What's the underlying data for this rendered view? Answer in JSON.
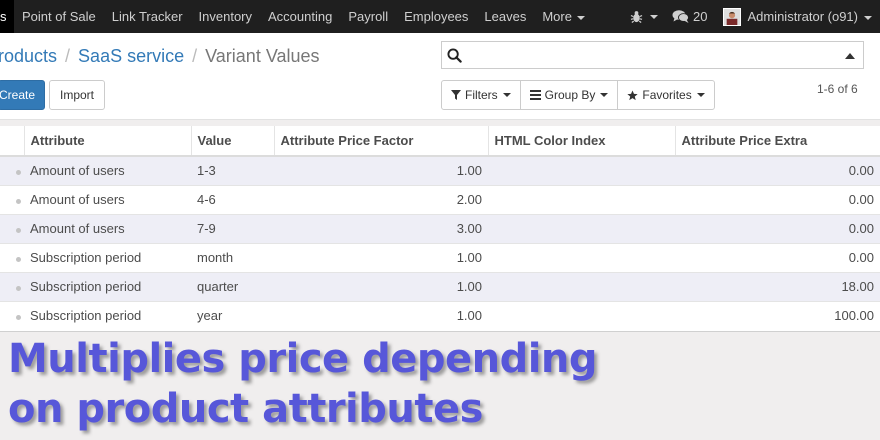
{
  "navbar": {
    "first_item": "s",
    "menu": [
      {
        "label": "Point of Sale",
        "caret": false
      },
      {
        "label": "Link Tracker",
        "caret": false
      },
      {
        "label": "Inventory",
        "caret": false
      },
      {
        "label": "Accounting",
        "caret": false
      },
      {
        "label": "Payroll",
        "caret": false
      },
      {
        "label": "Employees",
        "caret": false
      },
      {
        "label": "Leaves",
        "caret": false
      },
      {
        "label": "More",
        "caret": true
      }
    ],
    "debug_icon": "bug-icon",
    "messages_count": "20",
    "user": "Administrator (o91)"
  },
  "breadcrumb": {
    "items": [
      "roducts",
      "SaaS service"
    ],
    "current": "Variant Values"
  },
  "search": {
    "placeholder": ""
  },
  "buttons": {
    "create": "Create",
    "import": "Import"
  },
  "filters": {
    "filters": "Filters",
    "group_by": "Group By",
    "favorites": "Favorites"
  },
  "pager": "1-6 of 6",
  "table": {
    "columns": [
      "Attribute",
      "Value",
      "Attribute Price Factor",
      "HTML Color Index",
      "Attribute Price Extra"
    ],
    "rows": [
      {
        "attribute": "Amount of users",
        "value": "1-3",
        "factor": "1.00",
        "color_index": "",
        "extra": "0.00"
      },
      {
        "attribute": "Amount of users",
        "value": "4-6",
        "factor": "2.00",
        "color_index": "",
        "extra": "0.00"
      },
      {
        "attribute": "Amount of users",
        "value": "7-9",
        "factor": "3.00",
        "color_index": "",
        "extra": "0.00"
      },
      {
        "attribute": "Subscription period",
        "value": "month",
        "factor": "1.00",
        "color_index": "",
        "extra": "0.00"
      },
      {
        "attribute": "Subscription period",
        "value": "quarter",
        "factor": "1.00",
        "color_index": "",
        "extra": "18.00"
      },
      {
        "attribute": "Subscription period",
        "value": "year",
        "factor": "1.00",
        "color_index": "",
        "extra": "100.00"
      }
    ]
  },
  "caption": {
    "line1": "Multiplies price depending",
    "line2": "on product attributes"
  },
  "colors": {
    "navbar": "#1f1f1f",
    "primary": "#337ab7",
    "caption": "#5757d9",
    "stripe": "#eeeef6"
  }
}
